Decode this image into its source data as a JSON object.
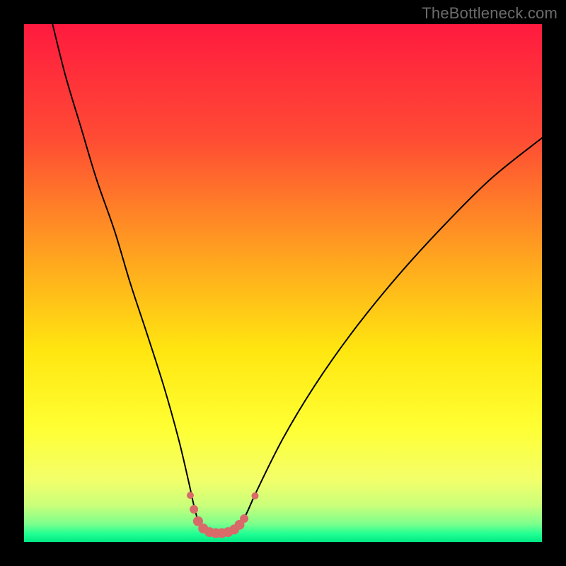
{
  "watermark": "TheBottleneck.com",
  "chart_data": {
    "type": "line",
    "title": "",
    "xlabel": "",
    "ylabel": "",
    "x_range": [
      0,
      100
    ],
    "y_range": [
      0,
      100
    ],
    "gradient_stops": [
      {
        "offset": 0.0,
        "color": "#ff1a3f"
      },
      {
        "offset": 0.22,
        "color": "#ff4b34"
      },
      {
        "offset": 0.45,
        "color": "#ffa41f"
      },
      {
        "offset": 0.63,
        "color": "#ffe610"
      },
      {
        "offset": 0.78,
        "color": "#ffff33"
      },
      {
        "offset": 0.88,
        "color": "#f3ff6a"
      },
      {
        "offset": 0.93,
        "color": "#c9ff7a"
      },
      {
        "offset": 0.965,
        "color": "#7dff8c"
      },
      {
        "offset": 0.985,
        "color": "#1fff93"
      },
      {
        "offset": 1.0,
        "color": "#00e884"
      }
    ],
    "series": [
      {
        "name": "left-curve",
        "stroke": "#000000",
        "stroke_width": 2,
        "points": [
          {
            "x": 5.5,
            "y": 100
          },
          {
            "x": 8,
            "y": 90
          },
          {
            "x": 11,
            "y": 80
          },
          {
            "x": 14,
            "y": 70
          },
          {
            "x": 17.5,
            "y": 60
          },
          {
            "x": 20.5,
            "y": 50
          },
          {
            "x": 23.8,
            "y": 40
          },
          {
            "x": 27,
            "y": 30
          },
          {
            "x": 29.8,
            "y": 20
          },
          {
            "x": 31.7,
            "y": 12
          },
          {
            "x": 32.8,
            "y": 7
          },
          {
            "x": 33.6,
            "y": 4
          }
        ]
      },
      {
        "name": "right-curve",
        "stroke": "#000000",
        "stroke_width": 2,
        "points": [
          {
            "x": 42.3,
            "y": 4.2
          },
          {
            "x": 43.2,
            "y": 6
          },
          {
            "x": 45,
            "y": 10
          },
          {
            "x": 50,
            "y": 20
          },
          {
            "x": 56,
            "y": 30
          },
          {
            "x": 63,
            "y": 40
          },
          {
            "x": 71,
            "y": 50
          },
          {
            "x": 80,
            "y": 60
          },
          {
            "x": 90,
            "y": 70
          },
          {
            "x": 100,
            "y": 78
          }
        ]
      }
    ],
    "marker_series": {
      "name": "bottom-markers",
      "color": "#d86a6a",
      "points": [
        {
          "x": 32.1,
          "y": 9.0,
          "r": 5
        },
        {
          "x": 32.8,
          "y": 6.3,
          "r": 6
        },
        {
          "x": 33.6,
          "y": 4.0,
          "r": 7
        },
        {
          "x": 34.6,
          "y": 2.6,
          "r": 7
        },
        {
          "x": 35.8,
          "y": 1.9,
          "r": 7
        },
        {
          "x": 37.0,
          "y": 1.7,
          "r": 7
        },
        {
          "x": 38.2,
          "y": 1.7,
          "r": 7
        },
        {
          "x": 39.4,
          "y": 1.9,
          "r": 7
        },
        {
          "x": 40.6,
          "y": 2.4,
          "r": 7
        },
        {
          "x": 41.6,
          "y": 3.3,
          "r": 7
        },
        {
          "x": 42.5,
          "y": 4.5,
          "r": 6
        },
        {
          "x": 44.6,
          "y": 8.9,
          "r": 5
        }
      ]
    }
  }
}
